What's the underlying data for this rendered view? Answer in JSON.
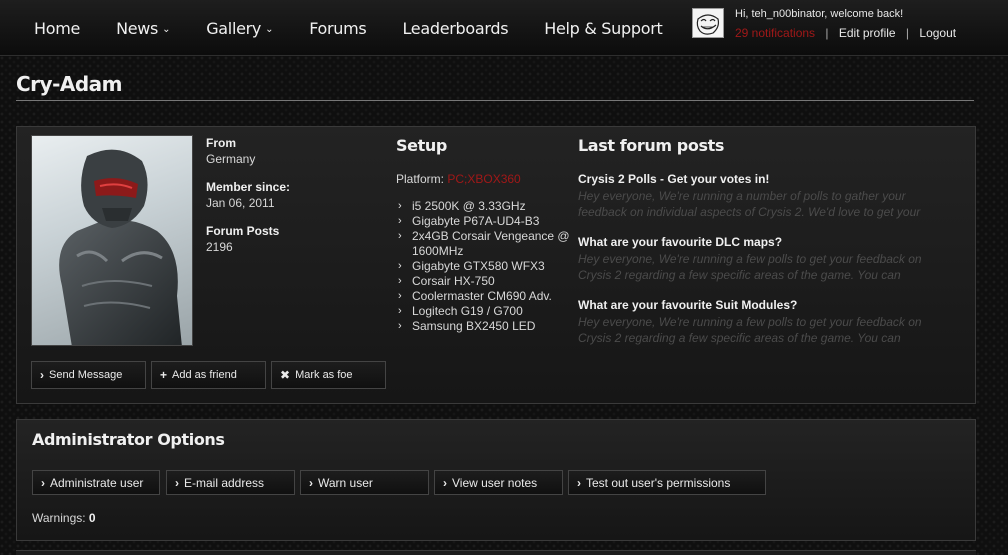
{
  "nav": {
    "items": [
      {
        "label": "Home",
        "dropdown": false
      },
      {
        "label": "News",
        "dropdown": true
      },
      {
        "label": "Gallery",
        "dropdown": true
      },
      {
        "label": "Forums",
        "dropdown": false
      },
      {
        "label": "Leaderboards",
        "dropdown": false
      },
      {
        "label": "Help & Support",
        "dropdown": false
      }
    ],
    "chevron": "⌄"
  },
  "user": {
    "welcome": "Hi, teh_n00binator, welcome back!",
    "notifications": "29 notifications",
    "edit_profile": "Edit profile",
    "logout": "Logout",
    "separator": "|",
    "avatar_icon": "troll-face-avatar"
  },
  "profile": {
    "name": "Cry-Adam",
    "from_label": "From",
    "from_value": "Germany",
    "member_since_label": "Member since:",
    "member_since_value": "Jan 06, 2011",
    "forum_posts_label": "Forum Posts",
    "forum_posts_value": "2196",
    "buttons": {
      "send_message": "Send Message",
      "add_friend": "Add as friend",
      "mark_foe": "Mark as foe"
    }
  },
  "setup": {
    "heading": "Setup",
    "platform_label": "Platform:",
    "platform_value": "PC;XBOX360",
    "bullet": "›",
    "items": [
      "i5 2500K @ 3.33GHz",
      "Gigabyte P67A-UD4-B3",
      "2x4GB Corsair Vengeance @ 1600MHz",
      "Gigabyte GTX580 WFX3",
      "Corsair HX-750",
      "Coolermaster CM690 Adv.",
      "Logitech G19 / G700",
      "Samsung BX2450 LED"
    ]
  },
  "last_posts": {
    "heading": "Last forum posts",
    "posts": [
      {
        "title": "Crysis 2 Polls - Get your votes in!",
        "excerpt": "Hey everyone, We're running a number of polls to gather your feedback on individual aspects of Crysis 2. We'd love to get your"
      },
      {
        "title": "What are your favourite DLC maps?",
        "excerpt": "Hey everyone, We're running a few polls to get your feedback on Crysis 2 regarding a few specific areas of the game. You can"
      },
      {
        "title": "What are your favourite Suit Modules?",
        "excerpt": "Hey everyone, We're running a few polls to get your feedback on Crysis 2 regarding a few specific areas of the game. You can"
      }
    ]
  },
  "admin": {
    "heading": "Administrator Options",
    "buttons": [
      "Administrate user",
      "E-mail address",
      "Warn user",
      "View user notes",
      "Test out user's permissions"
    ],
    "warnings_label": "Warnings:",
    "warnings_value": "0"
  },
  "colors": {
    "accent_red": "#a01818",
    "excerpt_gray": "#4b4b4b"
  }
}
